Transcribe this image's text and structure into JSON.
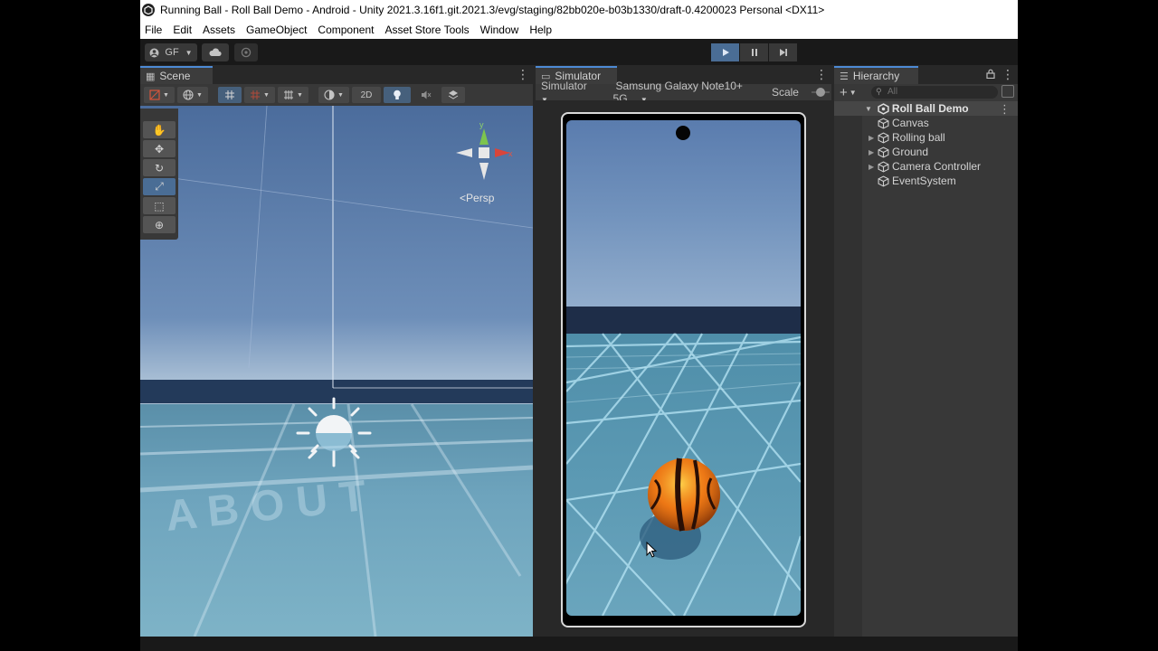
{
  "window": {
    "title": "Running Ball - Roll Ball Demo - Android - Unity 2021.3.16f1.git.2021.3/evg/staging/82bb020e-b03b1330/draft-0.4200023 Personal <DX11>"
  },
  "menu": [
    "File",
    "Edit",
    "Assets",
    "GameObject",
    "Component",
    "Asset Store Tools",
    "Window",
    "Help"
  ],
  "toolbar": {
    "account_label": "GF"
  },
  "scene": {
    "tab_label": "Scene",
    "toggle_2d_label": "2D",
    "persp_label": "Persp",
    "gizmo_y_label": "y",
    "gizmo_x_label": "x"
  },
  "simulator": {
    "tab_label": "Simulator",
    "mode_label": "Simulator",
    "device_label": "Samsung Galaxy Note10+ 5G",
    "scale_label": "Scale"
  },
  "hierarchy": {
    "tab_label": "Hierarchy",
    "search_placeholder": "All",
    "root": "Roll Ball Demo",
    "items": [
      {
        "label": "Canvas",
        "expandable": false
      },
      {
        "label": "Rolling ball",
        "expandable": true
      },
      {
        "label": "Ground",
        "expandable": true
      },
      {
        "label": "Camera Controller",
        "expandable": true
      },
      {
        "label": "EventSystem",
        "expandable": false
      }
    ]
  },
  "colors": {
    "accent": "#4d8ad4",
    "play_active": "#4a6d95",
    "panel": "#383838",
    "ball_orange": "#f07a12"
  }
}
